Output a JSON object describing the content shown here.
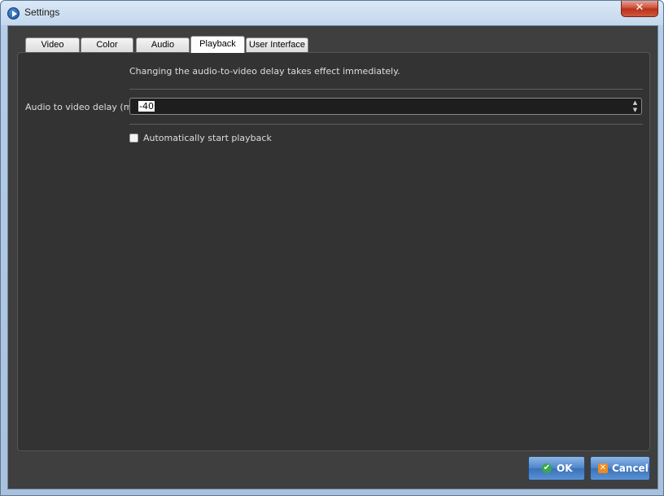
{
  "window": {
    "title": "Settings",
    "close_label": "✕"
  },
  "tabs": [
    {
      "label": "Video",
      "active": false
    },
    {
      "label": "Color",
      "active": false
    },
    {
      "label": "Audio",
      "active": false
    },
    {
      "label": "Playback",
      "active": true
    },
    {
      "label": "User Interface",
      "active": false
    }
  ],
  "playback": {
    "info_text": "Changing the audio-to-video delay takes effect immediately.",
    "delay_label": "Audio to video delay (ms)",
    "delay_value": "-40",
    "spin_up": "▲",
    "spin_down": "▼",
    "autostart_label": "Automatically start playback",
    "autostart_checked": false
  },
  "buttons": {
    "ok_label": "OK",
    "ok_icon": "✔",
    "cancel_label": "Cancel",
    "cancel_icon": "✕"
  },
  "colors": {
    "panel_bg": "#333333",
    "client_bg": "#3f3f3f",
    "button_blue": "#4f86cb"
  }
}
